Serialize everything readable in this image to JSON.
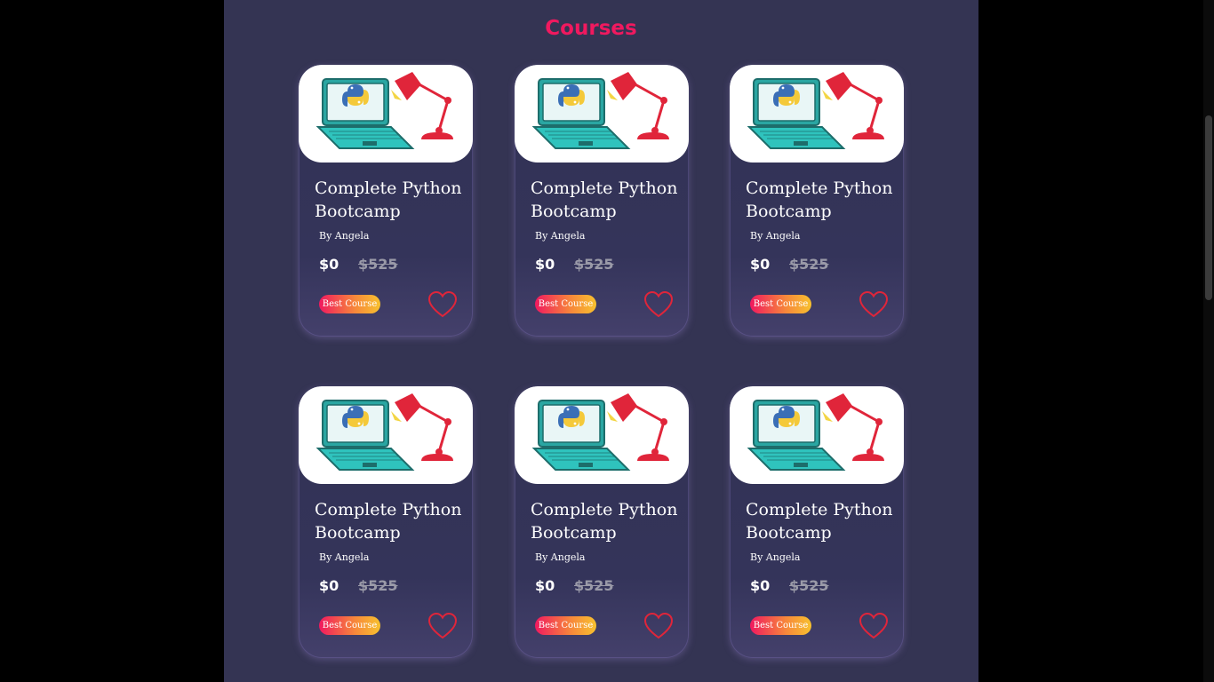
{
  "page": {
    "title": "Courses"
  },
  "colors": {
    "background": "#343453",
    "title_accent": "#f0195f",
    "badge_gradient_start": "#f0195f",
    "badge_gradient_end": "#f7c12e",
    "heart": "#e0253a",
    "strike_price": "#9a9aa8"
  },
  "courses": [
    {
      "title": "Complete Python Bootcamp",
      "author": "By Angela",
      "price": "$0",
      "original_price": "$525",
      "badge": "Best Course",
      "image_icon": "python-laptop-lamp-illustration",
      "favorite_icon": "heart-icon"
    },
    {
      "title": "Complete Python Bootcamp",
      "author": "By Angela",
      "price": "$0",
      "original_price": "$525",
      "badge": "Best Course",
      "image_icon": "python-laptop-lamp-illustration",
      "favorite_icon": "heart-icon"
    },
    {
      "title": "Complete Python Bootcamp",
      "author": "By Angela",
      "price": "$0",
      "original_price": "$525",
      "badge": "Best Course",
      "image_icon": "python-laptop-lamp-illustration",
      "favorite_icon": "heart-icon"
    },
    {
      "title": "Complete Python Bootcamp",
      "author": "By Angela",
      "price": "$0",
      "original_price": "$525",
      "badge": "Best Course",
      "image_icon": "python-laptop-lamp-illustration",
      "favorite_icon": "heart-icon"
    },
    {
      "title": "Complete Python Bootcamp",
      "author": "By Angela",
      "price": "$0",
      "original_price": "$525",
      "badge": "Best Course",
      "image_icon": "python-laptop-lamp-illustration",
      "favorite_icon": "heart-icon"
    },
    {
      "title": "Complete Python Bootcamp",
      "author": "By Angela",
      "price": "$0",
      "original_price": "$525",
      "badge": "Best Course",
      "image_icon": "python-laptop-lamp-illustration",
      "favorite_icon": "heart-icon"
    }
  ]
}
